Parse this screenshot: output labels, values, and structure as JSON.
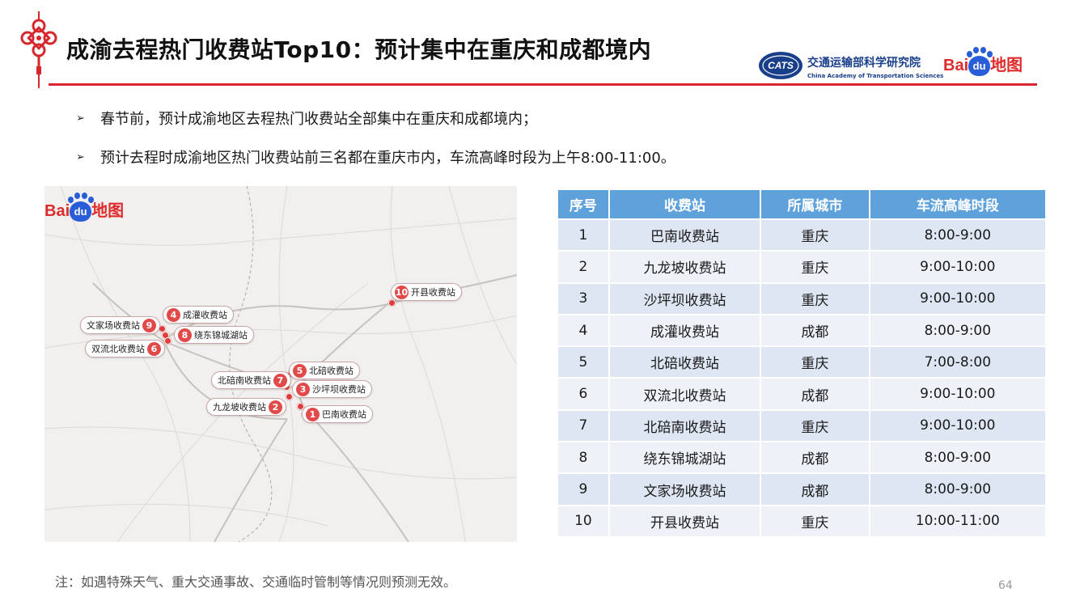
{
  "header": {
    "title": "成渝去程热门收费站Top10：预计集中在重庆和成都境内",
    "org_cn": "交通运输部科学研究院",
    "org_en": "China Academy of Transportation Sciences",
    "org_logo_text": "CATS",
    "baidu_bai": "Bai",
    "baidu_du": "du",
    "baidu_map": "地图"
  },
  "bullets": [
    "春节前，预计成渝地区去程热门收费站全部集中在重庆和成都境内；",
    "预计去程时成渝地区热门收费站前三名都在重庆市内，车流高峰时段为上午8:00-11:00。"
  ],
  "bullet_arrow": "➢",
  "map": {
    "baidu_bai": "Bai",
    "baidu_du": "du",
    "baidu_map": "地图",
    "markers": [
      {
        "num": "10",
        "name": "开县收费站"
      },
      {
        "num": "4",
        "name": "成灌收费站"
      },
      {
        "num": "9",
        "name": "文家场收费站"
      },
      {
        "num": "8",
        "name": "绕东锦城湖站"
      },
      {
        "num": "6",
        "name": "双流北收费站"
      },
      {
        "num": "5",
        "name": "北碚收费站"
      },
      {
        "num": "7",
        "name": "北碚南收费站"
      },
      {
        "num": "3",
        "name": "沙坪坝收费站"
      },
      {
        "num": "2",
        "name": "九龙坡收费站"
      },
      {
        "num": "1",
        "name": "巴南收费站"
      }
    ]
  },
  "table": {
    "headers": [
      "序号",
      "收费站",
      "所属城市",
      "车流高峰时段"
    ],
    "rows": [
      [
        "1",
        "巴南收费站",
        "重庆",
        "8:00-9:00"
      ],
      [
        "2",
        "九龙坡收费站",
        "重庆",
        "9:00-10:00"
      ],
      [
        "3",
        "沙坪坝收费站",
        "重庆",
        "9:00-10:00"
      ],
      [
        "4",
        "成灌收费站",
        "成都",
        "8:00-9:00"
      ],
      [
        "5",
        "北碚收费站",
        "重庆",
        "7:00-8:00"
      ],
      [
        "6",
        "双流北收费站",
        "成都",
        "9:00-10:00"
      ],
      [
        "7",
        "北碚南收费站",
        "重庆",
        "9:00-10:00"
      ],
      [
        "8",
        "绕东锦城湖站",
        "成都",
        "8:00-9:00"
      ],
      [
        "9",
        "文家场收费站",
        "成都",
        "8:00-9:00"
      ],
      [
        "10",
        "开县收费站",
        "重庆",
        "10:00-11:00"
      ]
    ]
  },
  "footer": {
    "note": "注：如遇特殊天气、重大交通事故、交通临时管制等情况则预测无效。",
    "page_number": "64"
  },
  "colors": {
    "accent_red": "#d9262c",
    "table_header": "#5fa2db",
    "table_row": "#dde6f2",
    "table_row_alt": "#eef2f8",
    "baidu_blue": "#2a5ed8"
  }
}
